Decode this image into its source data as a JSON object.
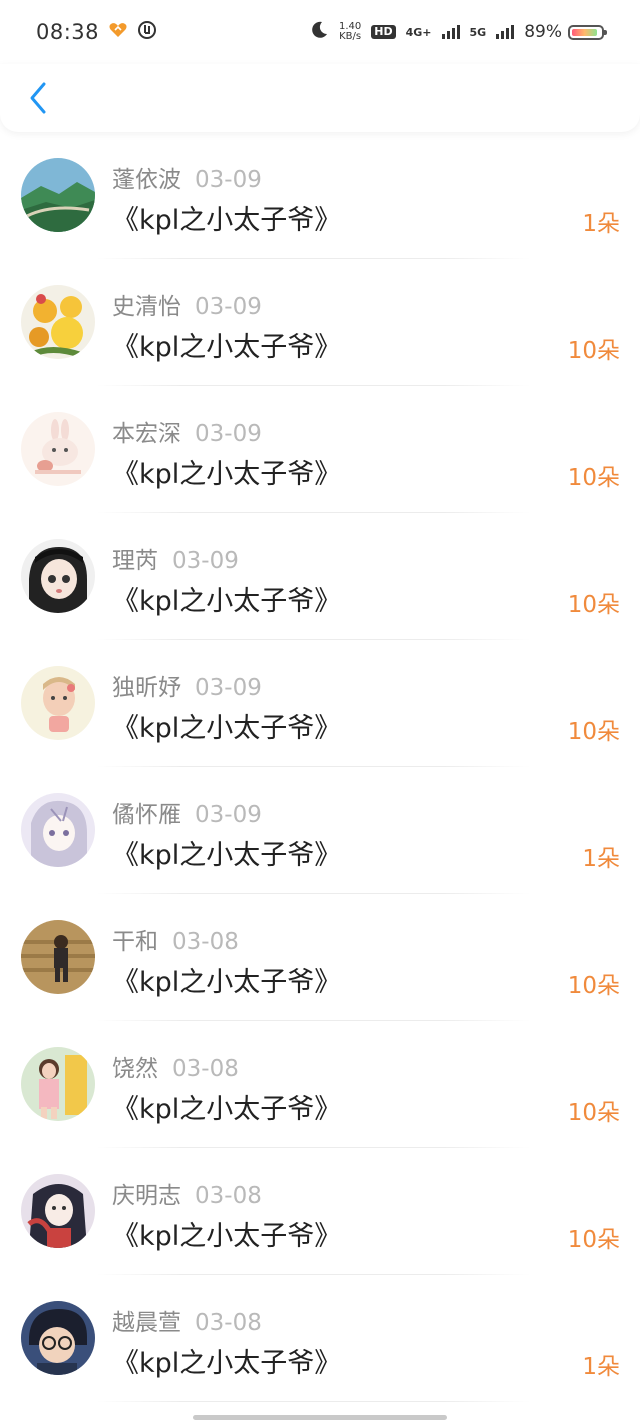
{
  "status_bar": {
    "time": "08:38",
    "net_speed": "1.40",
    "net_unit": "KB/s",
    "hd_label": "HD",
    "net_4g": "4G+",
    "net_5g": "5G",
    "battery_text": "89%",
    "battery_level": 0.89
  },
  "header": {
    "back_icon": "chevron-left-icon",
    "accent_color": "#2196f3"
  },
  "records": [
    {
      "name": "蓬依波",
      "date": "03-09",
      "title": "《kpl之小太子爷》",
      "gift": "1朵",
      "avatar": "landscape"
    },
    {
      "name": "史清怡",
      "date": "03-09",
      "title": "《kpl之小太子爷》",
      "gift": "10朵",
      "avatar": "flowers"
    },
    {
      "name": "本宏深",
      "date": "03-09",
      "title": "《kpl之小太子爷》",
      "gift": "10朵",
      "avatar": "bunny"
    },
    {
      "name": "理芮",
      "date": "03-09",
      "title": "《kpl之小太子爷》",
      "gift": "10朵",
      "avatar": "anime-girl-cap"
    },
    {
      "name": "独昕妤",
      "date": "03-09",
      "title": "《kpl之小太子爷》",
      "gift": "10朵",
      "avatar": "cartoon-girl"
    },
    {
      "name": "僪怀雁",
      "date": "03-09",
      "title": "《kpl之小太子爷》",
      "gift": "1朵",
      "avatar": "anime-girl-pale"
    },
    {
      "name": "干和",
      "date": "03-08",
      "title": "《kpl之小太子爷》",
      "gift": "10朵",
      "avatar": "girl-on-stairs"
    },
    {
      "name": "饶然",
      "date": "03-08",
      "title": "《kpl之小太子爷》",
      "gift": "10朵",
      "avatar": "girl-photo"
    },
    {
      "name": "庆明志",
      "date": "03-08",
      "title": "《kpl之小太子爷》",
      "gift": "10朵",
      "avatar": "ancient-lady"
    },
    {
      "name": "越晨萱",
      "date": "03-08",
      "title": "《kpl之小太子爷》",
      "gift": "1朵",
      "avatar": "anime-boy-glasses"
    }
  ],
  "colors": {
    "gift": "#f08a3c",
    "name": "#8a8a8a",
    "date": "#b9b9b9",
    "title": "#222222"
  }
}
